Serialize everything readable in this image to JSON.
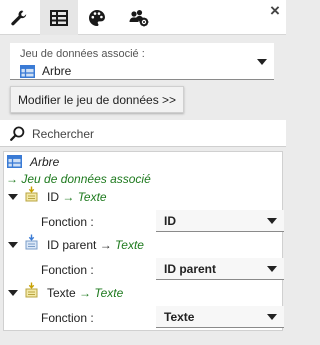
{
  "tabs": [
    {
      "icon": "wrench-icon",
      "active": false
    },
    {
      "icon": "table-icon",
      "active": true
    },
    {
      "icon": "palette-icon",
      "active": false
    },
    {
      "icon": "users-gear-icon",
      "active": false
    }
  ],
  "close_glyph": "×",
  "dataset": {
    "label": "Jeu de données associé :",
    "value": "Arbre"
  },
  "modify_button": "Modifier le jeu de données >>",
  "search": {
    "placeholder": "Rechercher",
    "value": ""
  },
  "tree": {
    "root_label": "Arbre",
    "linked_label": "→ Jeu de données associé",
    "function_label": "Fonction :",
    "fields": [
      {
        "name": "ID",
        "arrow": "→",
        "type": "Texte",
        "function": "ID"
      },
      {
        "name": "ID parent",
        "arrow": "→",
        "type": "Texte",
        "function": "ID parent"
      },
      {
        "name": "Texte",
        "arrow": "→",
        "type": "Texte",
        "function": "Texte"
      }
    ]
  },
  "colors": {
    "accent": "#3a7bd5",
    "type_text": "#1e7a1e",
    "field_icon": "#d4c25a"
  }
}
